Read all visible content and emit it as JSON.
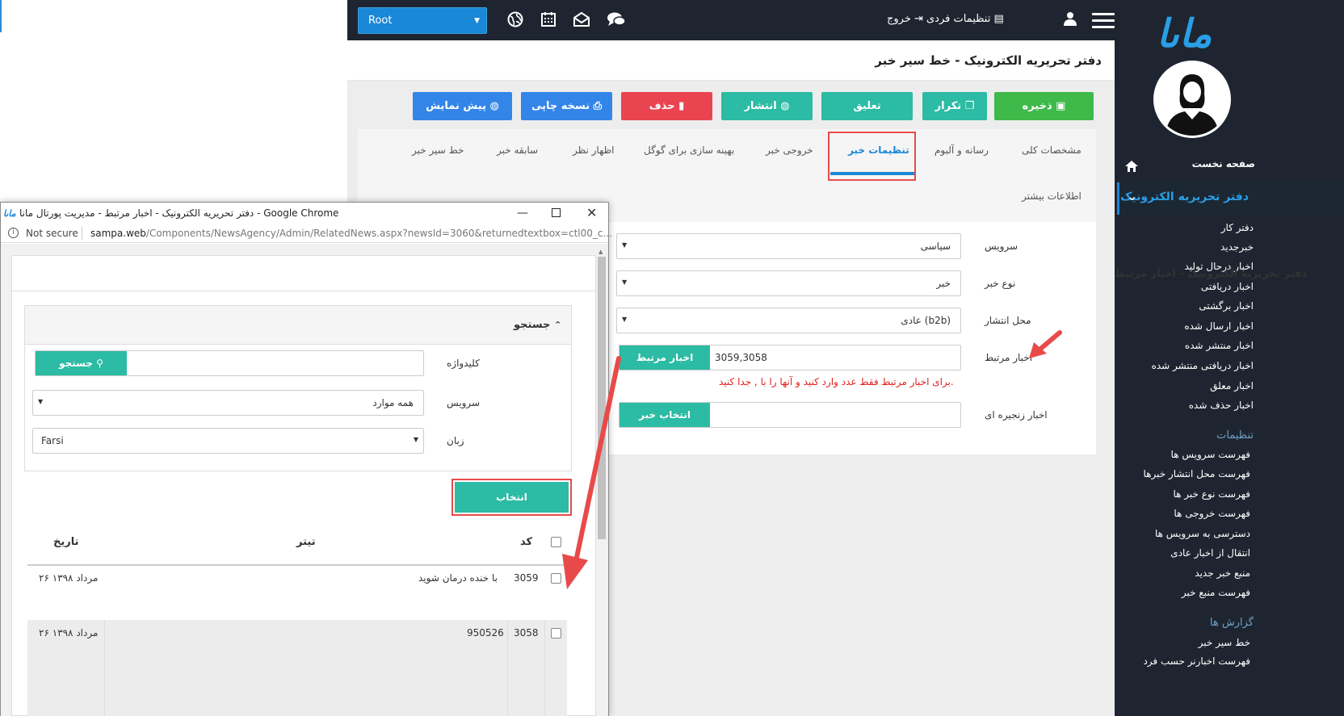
{
  "topbar": {
    "root_select": "Root",
    "personal_settings": "تنظیمات فردی",
    "logout": "خروج"
  },
  "sidebar": {
    "logo": "ماںا",
    "home": "صفحه نخست",
    "active_section": "دفتر تحریریه الکترونیک",
    "items": [
      "دفتر کار",
      "خبرجدید",
      "اخبار درحال تولید",
      "اخبار دریافتی",
      "اخبار برگشتی",
      "اخبار ارسال شده",
      "اخبار منتشر شده",
      "اخبار دریافتی منتشر شده",
      "اخبار معلق",
      "اخبار حذف شده"
    ],
    "settings_header": "تنظیمات",
    "settings_items": [
      "فهرست سرویس ها",
      "فهرست محل انتشار خبرها",
      "فهرست نوع خبر ها",
      "فهرست خروجی ها",
      "دسترسی به سرویس ها",
      "انتقال از اخبار عادی",
      "منبع خبر جدید",
      "فهرست منبع خبر"
    ],
    "reports_header": "گزارش ها",
    "reports_items": [
      "خط سیر خبر",
      "فهرست اخبارنر حسب فرد"
    ]
  },
  "page": {
    "title": "دفتر تحریریه الکترونیک - خط سیر خبر"
  },
  "toolbar": {
    "save": "ذخیره",
    "duplicate": "تکرار",
    "suspend": "تعلیق",
    "publish": "انتشار",
    "delete": "حذف",
    "print": "نسخه چاپی",
    "preview": "پیش نمایش"
  },
  "tabs": {
    "general": "مشخصات کلی",
    "media": "رسانه و آلبوم",
    "news_settings": "تنظیمات خبر",
    "output": "خروجی خبر",
    "seo": "بهینه سازی برای گوگل",
    "comments": "اظهار نظر",
    "history": "سابقه خبر",
    "route": "خط سیر خبر",
    "more_info": "اطلاعات بیشتر"
  },
  "form": {
    "service_label": "سرویس",
    "service_value": "سیاسی",
    "type_label": "نوع خبر",
    "type_value": "خبر",
    "place_label": "محل انتشار",
    "place_value": "عادی (b2b)",
    "related_label": "اخبار مرتبط",
    "related_value": "3059,3058",
    "related_button": "اخبار مرتبط",
    "related_note": "برای اخبار مرتبط فقط عدد وارد کنید و آنها را با , جدا کنید.",
    "chain_label": "اخبار زنجیره ای",
    "chain_button": "انتخاب خبر"
  },
  "popup": {
    "window_title": "دفتر تحریریه الکترونیک - اخبار مرتبط - مدیریت پورتال مانا - Google Chrome",
    "not_secure": "Not secure",
    "url_host": "sampa.web",
    "url_path": "/Components/NewsAgency/Admin/RelatedNews.aspx?newsId=3060&returnedtextbox=ctl00_c...",
    "heading": "دفتر تحریریه الکترونیک - اخبار مرتبط",
    "search_section": "جستجو",
    "keyword_label": "کلیدواژه",
    "search_button": "جستجو",
    "service_label": "سرویس",
    "service_value": "همه موارد",
    "language_label": "زبان",
    "language_value": "Farsi",
    "select_button": "انتخاب",
    "columns": {
      "code": "کد",
      "title": "تیتر",
      "date": "تاریخ"
    },
    "rows": [
      {
        "code": "3059",
        "title": "با خنده درمان شوید",
        "date": "۲۶ مرداد ۱۳۹۸"
      },
      {
        "code": "3058",
        "title": "950526",
        "date": "۲۶ مرداد ۱۳۹۸"
      }
    ]
  }
}
